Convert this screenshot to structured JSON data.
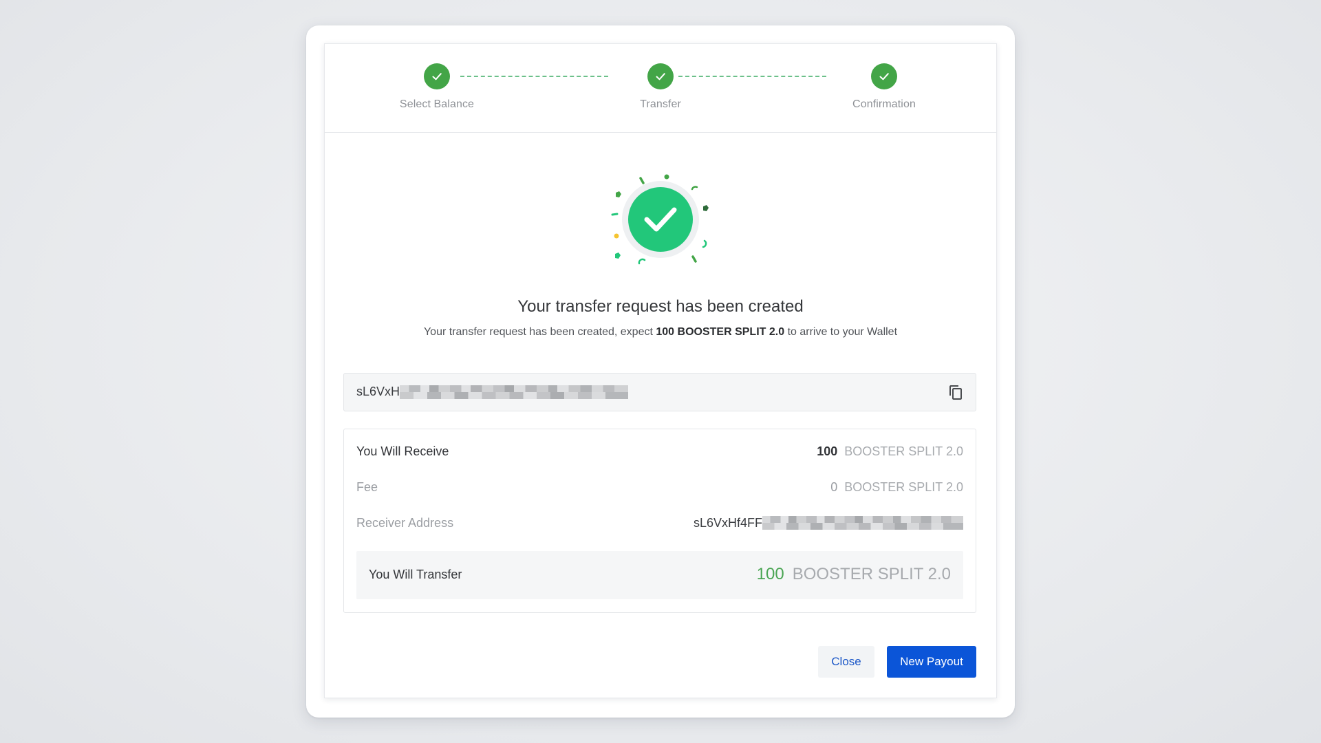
{
  "stepper": {
    "steps": [
      {
        "label": "Select Balance",
        "status": "complete"
      },
      {
        "label": "Transfer",
        "status": "complete"
      },
      {
        "label": "Confirmation",
        "status": "complete"
      }
    ]
  },
  "result": {
    "headline": "Your transfer request has been created",
    "sub_prefix": "Your transfer request has been created, expect",
    "sub_amount": "100 BOOSTER SPLIT 2.0",
    "sub_suffix": "to arrive to your Wallet"
  },
  "address_field": {
    "visible_value": "sL6VxH",
    "redacted": true
  },
  "summary": {
    "receive": {
      "label": "You Will Receive",
      "amount": "100",
      "currency": "BOOSTER SPLIT 2.0"
    },
    "fee": {
      "label": "Fee",
      "amount": "0",
      "currency": "BOOSTER SPLIT 2.0"
    },
    "receiver": {
      "label": "Receiver Address",
      "visible_value": "sL6VxHf4FF",
      "redacted": true
    },
    "transfer": {
      "label": "You Will Transfer",
      "amount": "100",
      "currency": "BOOSTER SPLIT 2.0"
    }
  },
  "actions": {
    "close_label": "Close",
    "new_payout_label": "New Payout"
  },
  "colors": {
    "step_complete": "#43a547",
    "success": "#22c77a",
    "primary": "#0b55d8",
    "link": "#1a56c7",
    "amount_positive": "#4aa553"
  },
  "icons": {
    "step": "checkmark-icon",
    "success": "success-check-icon",
    "copy": "copy-icon"
  }
}
